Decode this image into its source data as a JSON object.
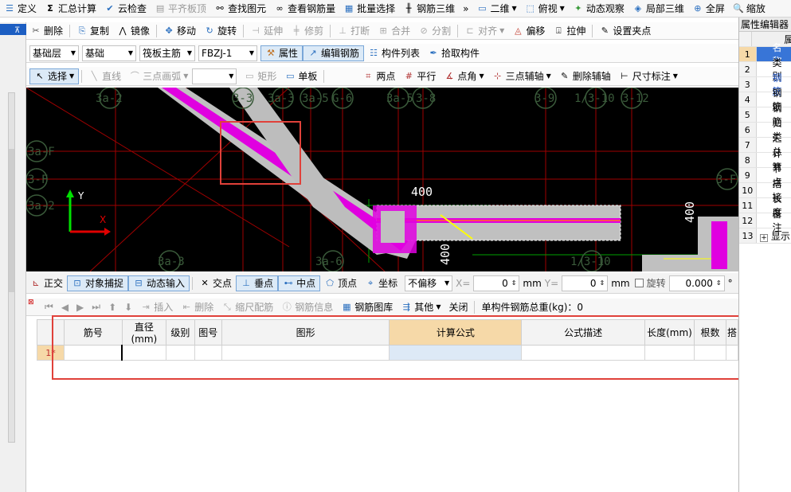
{
  "menubar": {
    "items": [
      "定义",
      "汇总计算",
      "云检查",
      "平齐板顶",
      "查找图元",
      "查看钢筋量",
      "批量选择",
      "钢筋三维",
      "二维",
      "俯视",
      "动态观察",
      "局部三维",
      "全屏",
      "缩放"
    ],
    "chevron": "»"
  },
  "toolbar1": [
    "删除",
    "复制",
    "镜像",
    "移动",
    "旋转",
    "延伸",
    "修剪",
    "打断",
    "合并",
    "分割",
    "对齐",
    "偏移",
    "拉伸",
    "设置夹点"
  ],
  "toolbar2": {
    "layer": "基础层",
    "category": "基础",
    "type": "筏板主筋",
    "element": "FBZJ-1",
    "buttons": [
      "属性",
      "编辑钢筋",
      "构件列表",
      "拾取构件"
    ]
  },
  "toolbar3": [
    "选择",
    "直线",
    "三点画弧",
    "矩形",
    "单板",
    "两点",
    "平行",
    "点角",
    "三点辅轴",
    "删除辅轴",
    "尺寸标注"
  ],
  "canvas": {
    "axis_labels_top": [
      "3a-2",
      "3-3",
      "3a-3",
      "3a-5",
      "G-6",
      "3a-5",
      "3-8",
      "3-9",
      "1/3-10",
      "3-12"
    ],
    "axis_labels_left": [
      "3a-F",
      "3-F",
      "3a-2"
    ],
    "axis_labels_bottom": [
      "3a-3",
      "3a-6",
      "1/3-10"
    ],
    "axis_label_right": "3-F",
    "dims": [
      "400",
      "400",
      "400"
    ],
    "ucs": {
      "x": "X",
      "y": "Y"
    }
  },
  "snapbar": {
    "items": [
      "正交",
      "对象捕捉",
      "动态输入",
      "交点",
      "垂点",
      "中点",
      "顶点",
      "坐标"
    ],
    "offset_mode": "不偏移",
    "x_label": "X=",
    "x_value": "0",
    "y_label": "Y=",
    "y_value": "0",
    "unit": "mm",
    "rotate_label": "旋转",
    "rotate_value": "0.000",
    "deg": "°"
  },
  "rebar_toolbar": {
    "items": [
      "插入",
      "删除",
      "缩尺配筋",
      "钢筋信息",
      "钢筋图库",
      "其他",
      "关闭"
    ],
    "total_weight": "单构件钢筋总重(kg)：0"
  },
  "rebar_table": {
    "columns": [
      "筋号",
      "直径(mm)",
      "级别",
      "图号",
      "图形",
      "计算公式",
      "公式描述",
      "长度(mm)",
      "根数",
      "搭"
    ],
    "row1": "1*"
  },
  "property_panel": {
    "title": "属性编辑器",
    "header": "属",
    "rows": [
      {
        "num": "1",
        "name": "名称"
      },
      {
        "num": "2",
        "name": "类别"
      },
      {
        "num": "3",
        "name": "钢筋"
      },
      {
        "num": "4",
        "name": "钢筋"
      },
      {
        "num": "5",
        "name": "钢筋"
      },
      {
        "num": "6",
        "name": "归类"
      },
      {
        "num": "7",
        "name": "汇总"
      },
      {
        "num": "8",
        "name": "计算"
      },
      {
        "num": "9",
        "name": "节点"
      },
      {
        "num": "10",
        "name": "搭接"
      },
      {
        "num": "11",
        "name": "长度"
      },
      {
        "num": "12",
        "name": "备注"
      },
      {
        "num": "13",
        "name": "显示"
      }
    ]
  },
  "colors": {
    "accent": "#2a6fbf",
    "highlight_red": "#e0413a",
    "slab": "#c0c0c0",
    "rebar": "#e000e0",
    "grid": "#b40000",
    "axis_label": "#3a5a3a"
  }
}
